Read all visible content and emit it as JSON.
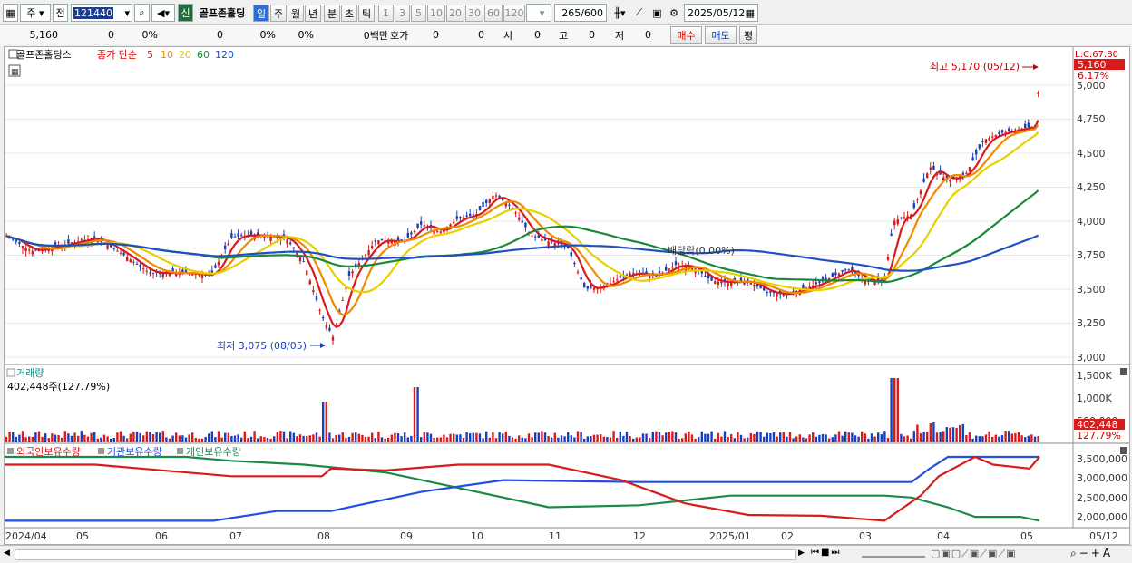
{
  "toolbar": {
    "period_label": "주",
    "prev_label": "전",
    "code_value": "121440",
    "new_badge": "신",
    "stock_name": "골프존홀딩",
    "periods": [
      "일",
      "주",
      "월",
      "년",
      "분",
      "초",
      "틱"
    ],
    "intervals": [
      "1",
      "3",
      "5",
      "10",
      "20",
      "30",
      "60",
      "120"
    ],
    "count_value": "265",
    "count_total": "/600",
    "date_value": "2025/05/12"
  },
  "quote": {
    "price": "5,160",
    "change": "0",
    "change_pct": "0%",
    "volume": "0",
    "vol_pct": "0%",
    "vol_pct2": "0%",
    "amount_label": "0백만",
    "hoga_label": "호가",
    "hoga_val1": "0",
    "hoga_val2": "0",
    "open_label": "시",
    "open_val": "0",
    "high_label": "고",
    "high_val": "0",
    "low_label": "저",
    "low_val": "0",
    "buy_label": "매수",
    "sell_label": "매도",
    "avg_label": "평"
  },
  "legend": {
    "stock": "골프존홀딩스",
    "ma_label": "종가 단순",
    "ma_values": [
      "5",
      "10",
      "20",
      "60",
      "120"
    ],
    "ma_colors": [
      "#d81b1b",
      "#f08a00",
      "#e8d000",
      "#1a8a3a",
      "#2050c0"
    ]
  },
  "annotations": {
    "high": "최고 5,170 (05/12)",
    "low": "최저 3,075 (08/05)",
    "dividend": "배당락(0.00%)",
    "last_price": "5,160",
    "last_pct": "6.17%",
    "topright": "L:C:67.80"
  },
  "price_axis": [
    "5,000",
    "4,750",
    "4,500",
    "4,250",
    "4,000",
    "3,750",
    "3,500",
    "3,250",
    "3,000"
  ],
  "volume_panel": {
    "title": "거래량",
    "value": "402,448주(127.79%)",
    "axis": [
      "1,500K",
      "1,000K",
      "500,000"
    ],
    "last_value": "402,448",
    "last_pct": "127.79%"
  },
  "holdings_panel": {
    "series": [
      "외국인보유수량",
      "기관보유수량",
      "개인보유수량"
    ],
    "axis": [
      "3,500,000",
      "3,000,000",
      "2,500,000",
      "2,000,000"
    ]
  },
  "date_axis": [
    "2024/04",
    "05",
    "06",
    "07",
    "08",
    "09",
    "10",
    "11",
    "12",
    "2025/01",
    "02",
    "03",
    "04",
    "05",
    "05/12"
  ],
  "colors": {
    "up": "#d81b1b",
    "down": "#1a3ec0",
    "foreign": "#d81b1b",
    "institution": "#2050e0",
    "individual": "#1a8a4a"
  }
}
